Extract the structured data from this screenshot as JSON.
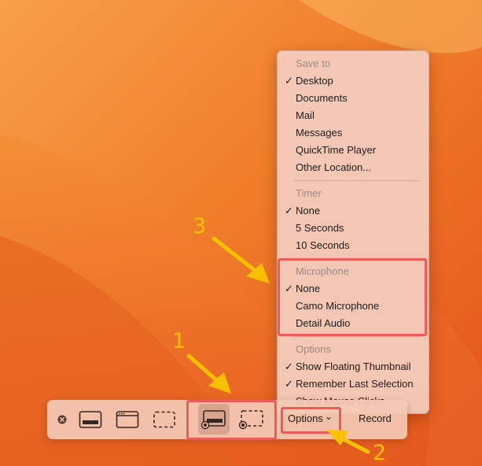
{
  "colors": {
    "highlight_red": "#ee5a58",
    "annotation_yellow": "#f7c100"
  },
  "menu": {
    "save_to": {
      "header": "Save to",
      "items": [
        {
          "label": "Desktop",
          "checked": true
        },
        {
          "label": "Documents",
          "checked": false
        },
        {
          "label": "Mail",
          "checked": false
        },
        {
          "label": "Messages",
          "checked": false
        },
        {
          "label": "QuickTime Player",
          "checked": false
        },
        {
          "label": "Other Location...",
          "checked": false
        }
      ]
    },
    "timer": {
      "header": "Timer",
      "items": [
        {
          "label": "None",
          "checked": true
        },
        {
          "label": "5 Seconds",
          "checked": false
        },
        {
          "label": "10 Seconds",
          "checked": false
        }
      ]
    },
    "microphone": {
      "header": "Microphone",
      "items": [
        {
          "label": "None",
          "checked": true
        },
        {
          "label": "Camo Microphone",
          "checked": false
        },
        {
          "label": "Detail Audio",
          "checked": false
        }
      ]
    },
    "options": {
      "header": "Options",
      "items": [
        {
          "label": "Show Floating Thumbnail",
          "checked": true
        },
        {
          "label": "Remember Last Selection",
          "checked": true
        },
        {
          "label": "Show Mouse Clicks",
          "checked": false
        }
      ]
    },
    "check_glyph": "✓"
  },
  "toolbar": {
    "options_label": "Options",
    "options_chevron": "⌄",
    "record_label": "Record",
    "icons": [
      "close-icon",
      "capture-entire-screen-icon",
      "capture-window-icon",
      "capture-selection-icon",
      "record-entire-screen-icon",
      "record-selection-icon"
    ]
  },
  "annotations": {
    "one": "1",
    "two": "2",
    "three": "3"
  }
}
